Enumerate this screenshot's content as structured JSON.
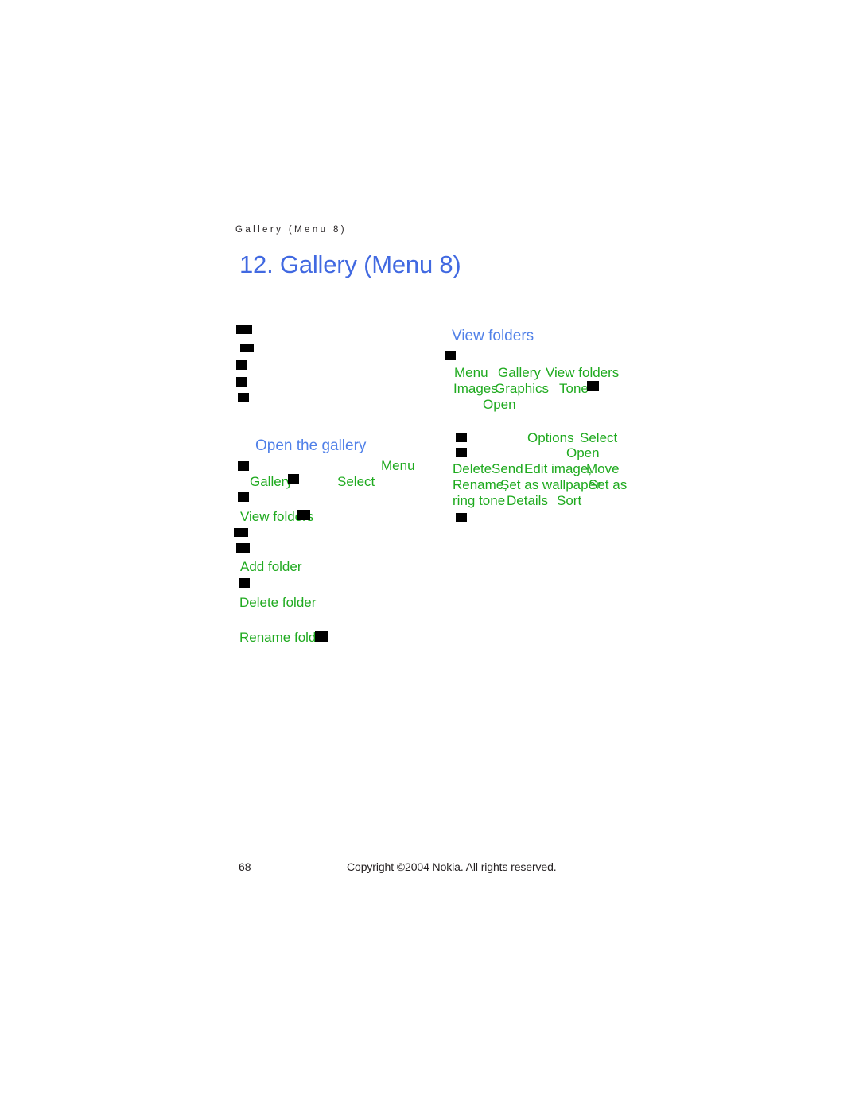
{
  "page": {
    "running_header": "Gallery (Menu 8)",
    "chapter_title": "12. Gallery (Menu 8)",
    "page_number": "68",
    "copyright": "Copyright ©2004 Nokia. All rights reserved.",
    "colors": {
      "chapter_title_blue": "#4169e1",
      "section_heading_blue": "#5080e8",
      "ui_string_green": "#1faa1f",
      "body_black": "#231f20",
      "missing_glyph_box": "#000000",
      "page_background": "#ffffff"
    }
  },
  "left_column": {
    "intro_bullets": [
      "",
      "",
      "",
      "",
      ""
    ],
    "section_heading": "Open the gallery",
    "lines": {
      "menu": "Menu",
      "gallery": "Gallery",
      "select": "Select",
      "view_folders": "View folders",
      "add_folder": "Add folder",
      "delete_folder": "Delete folder",
      "rename_folder": "Rename folder"
    }
  },
  "right_column": {
    "section_heading": "View folders",
    "lines": {
      "menu": "Menu",
      "gallery": "Gallery",
      "view_folders": "View folders",
      "images": "Images",
      "graphics": "Graphics",
      "tone": "Tone",
      "open_1": "Open",
      "options": "Options",
      "select": "Select",
      "open_2": "Open",
      "delete": "Delete",
      "send": "Send",
      "edit_image": "Edit image,",
      "move": "Move",
      "rename": "Rename,",
      "set_as_wallpaper": "Set as wallpaper",
      "set_as_overlap": "Set as",
      "ring_tone": "ring tone",
      "details": "Details",
      "sort": "Sort"
    }
  }
}
